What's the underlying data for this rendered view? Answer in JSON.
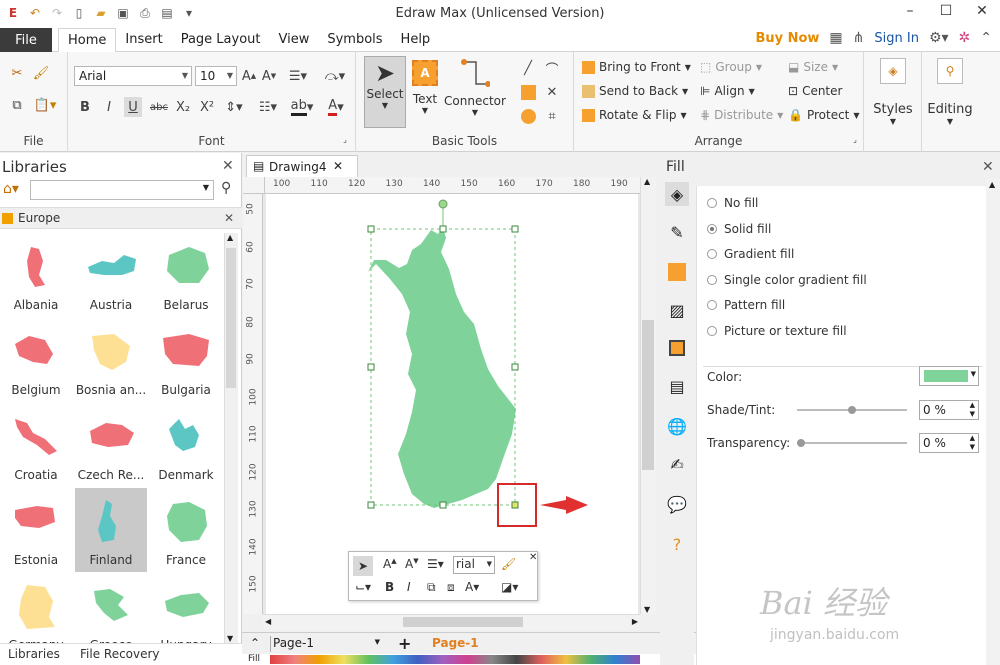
{
  "app": {
    "title": "Edraw Max (Unlicensed Version)"
  },
  "ribbon_tabs": [
    "File",
    "Home",
    "Insert",
    "Page Layout",
    "View",
    "Symbols",
    "Help"
  ],
  "account": {
    "buy_now": "Buy Now",
    "sign_in": "Sign In"
  },
  "font": {
    "family": "Arial",
    "size": "10"
  },
  "groups": {
    "file": "File",
    "font": "Font",
    "basic_tools": "Basic Tools",
    "arrange": "Arrange"
  },
  "basic_tools": {
    "select": "Select",
    "text": "Text",
    "connector": "Connector"
  },
  "arrange": {
    "bring_front": "Bring to Front",
    "send_back": "Send to Back",
    "rotate_flip": "Rotate & Flip",
    "group": "Group",
    "align": "Align",
    "distribute": "Distribute",
    "size": "Size",
    "center": "Center",
    "protect": "Protect"
  },
  "styles": "Styles",
  "editing": "Editing",
  "libraries": {
    "title": "Libraries",
    "category": "Europe",
    "items": [
      {
        "name": "Albania",
        "color": "#f07078"
      },
      {
        "name": "Austria",
        "color": "#5cc6c4"
      },
      {
        "name": "Belarus",
        "color": "#7ed29a"
      },
      {
        "name": "Belgium",
        "color": "#f07078"
      },
      {
        "name": "Bosnia an...",
        "color": "#fde094"
      },
      {
        "name": "Bulgaria",
        "color": "#f07078"
      },
      {
        "name": "Croatia",
        "color": "#f07078"
      },
      {
        "name": "Czech Re...",
        "color": "#f07078"
      },
      {
        "name": "Denmark",
        "color": "#5cc6c4"
      },
      {
        "name": "Estonia",
        "color": "#f07078"
      },
      {
        "name": "Finland",
        "color": "#5cc6c4"
      },
      {
        "name": "France",
        "color": "#7ed29a"
      },
      {
        "name": "Germany",
        "color": "#fde094"
      },
      {
        "name": "Greece",
        "color": "#7ed29a"
      },
      {
        "name": "Hungary",
        "color": "#7ed29a"
      }
    ],
    "tabs": {
      "libraries": "Libraries",
      "file_recovery": "File Recovery"
    }
  },
  "document": {
    "tab": "Drawing4",
    "page_name": "Page-1",
    "page_tab": "Page-1",
    "fill_label": "Fill"
  },
  "ruler": {
    "h": [
      "100",
      "110",
      "120",
      "130",
      "140",
      "150",
      "160",
      "170",
      "180",
      "190"
    ],
    "v": [
      "50",
      "60",
      "70",
      "80",
      "90",
      "100",
      "110",
      "120",
      "130",
      "140",
      "150"
    ]
  },
  "mini_toolbar": {
    "font": "rial"
  },
  "fill_panel": {
    "title": "Fill",
    "options": [
      "No fill",
      "Solid fill",
      "Gradient fill",
      "Single color gradient fill",
      "Pattern fill",
      "Picture or texture fill"
    ],
    "selected": "Solid fill",
    "color_label": "Color:",
    "shade_label": "Shade/Tint:",
    "shade_value": "0 %",
    "transparency_label": "Transparency:",
    "transparency_value": "0 %",
    "color": "#7ed29a"
  },
  "watermark": {
    "brand": "Bai 经验",
    "url": "jingyan.baidu.com"
  }
}
